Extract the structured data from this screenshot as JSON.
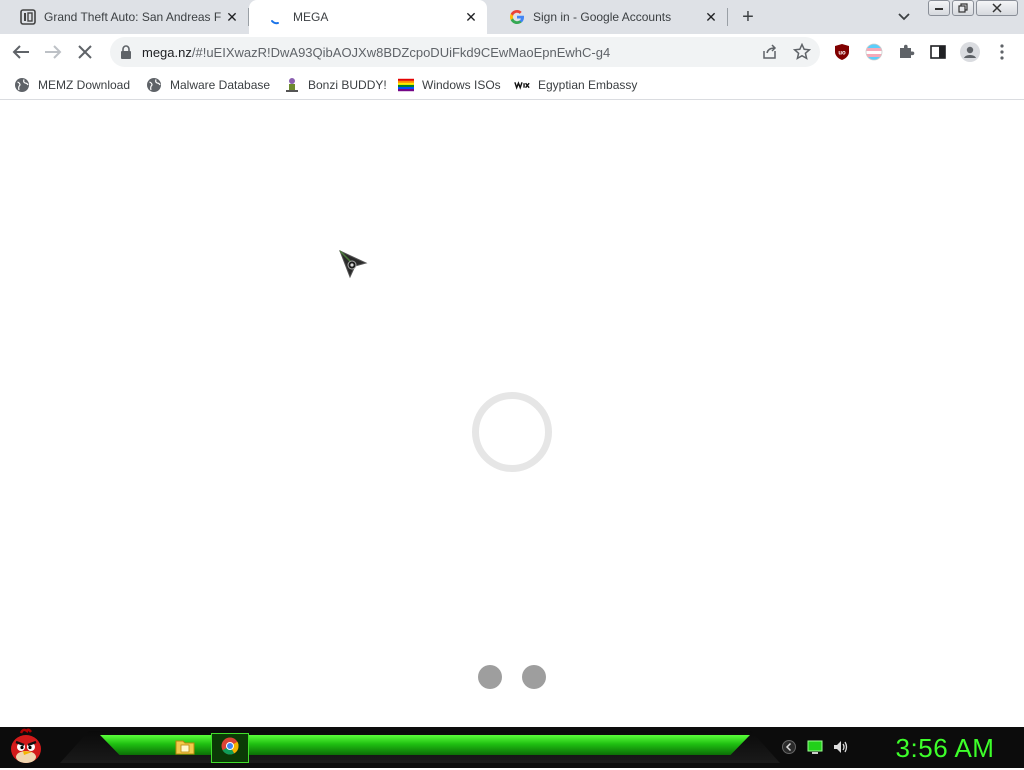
{
  "browser": {
    "tabs": [
      {
        "title": "Grand Theft Auto: San Andreas F",
        "favicon": "igdb-icon",
        "active": false
      },
      {
        "title": "MEGA",
        "favicon": "loading-spinner-icon",
        "active": true
      },
      {
        "title": "Sign in - Google Accounts",
        "favicon": "google-icon",
        "active": false
      }
    ],
    "new_tab": "+",
    "close_glyph": "✕",
    "window_controls": [
      "minimize",
      "restore",
      "close"
    ]
  },
  "toolbar": {
    "url_host": "mega.nz",
    "url_path": "/#!uEIXwazR!DwA93QibAOJXw8BDZcpoDUiFkd9CEwMaoEpnEwhC-g4",
    "extensions": [
      "share-icon",
      "bookmark-star-icon",
      "ublock-icon",
      "trans-flag-extension-icon",
      "puzzle-extensions-icon",
      "side-panel-icon",
      "profile-icon",
      "menu-kebab-icon"
    ]
  },
  "bookmarks": [
    {
      "label": "MEMZ Download",
      "icon": "globe-icon"
    },
    {
      "label": "Malware Database",
      "icon": "globe-icon"
    },
    {
      "label": "Bonzi BUDDY!",
      "icon": "bonzi-icon"
    },
    {
      "label": "Windows ISOs",
      "icon": "rainbow-flag-icon"
    },
    {
      "label": "Egyptian Embassy",
      "icon": "wix-icon"
    }
  ],
  "taskbar": {
    "clock": "3:56 AM",
    "items": [
      "file-explorer-icon",
      "chrome-icon"
    ],
    "tray": [
      "chevron-icon",
      "network-monitor-icon",
      "volume-icon"
    ],
    "accent": "#3dff2a"
  }
}
